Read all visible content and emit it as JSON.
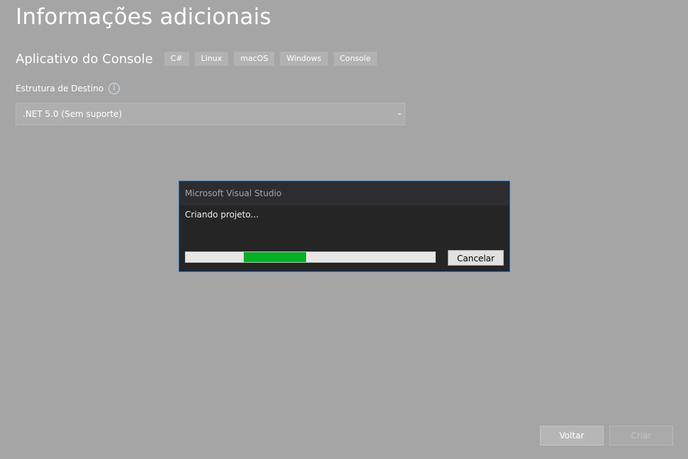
{
  "page": {
    "title": "Informações adicionais",
    "subtitle": "Aplicativo do Console",
    "tags": [
      "C#",
      "Linux",
      "macOS",
      "Windows",
      "Console"
    ]
  },
  "framework": {
    "label": "Estrutura de Destino",
    "info_icon": "info-icon",
    "selected": ".NET 5.0 (Sem suporte)"
  },
  "dialog": {
    "title": "Microsoft Visual Studio",
    "message": "Criando projeto...",
    "cancel_label": "Cancelar",
    "progress": {
      "segment_start_pct": 23.4,
      "segment_end_pct": 48.3,
      "fill_color": "#06b025"
    }
  },
  "footer": {
    "back_label": "Voltar",
    "create_label": "Criar"
  }
}
